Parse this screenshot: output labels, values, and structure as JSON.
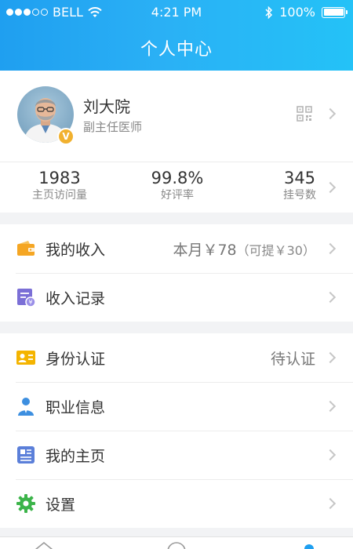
{
  "status_bar": {
    "carrier": "BELL",
    "time": "4:21 PM",
    "battery": "100%"
  },
  "nav": {
    "title": "个人中心"
  },
  "profile": {
    "name": "刘大院",
    "title": "副主任医师",
    "badge": "V"
  },
  "stats": [
    {
      "value": "1983",
      "label": "主页访问量"
    },
    {
      "value": "99.8%",
      "label": "好评率"
    },
    {
      "value": "345",
      "label": "挂号数"
    }
  ],
  "income": {
    "my_income": {
      "label": "我的收入",
      "value": "本月￥78",
      "sub": "（可提￥30）"
    },
    "records": {
      "label": "收入记录"
    }
  },
  "menu": {
    "identity": {
      "label": "身份认证",
      "value": "待认证"
    },
    "career": {
      "label": "职业信息"
    },
    "homepage": {
      "label": "我的主页"
    },
    "settings": {
      "label": "设置"
    }
  },
  "colors": {
    "header_start": "#1f9ff0",
    "header_end": "#24c2f7",
    "badge": "#f1b12f",
    "wallet": "#f5a623",
    "records": "#7b6fd6",
    "identity": "#f4b400",
    "career": "#3d8fe0",
    "homepage": "#5b7fd9",
    "settings": "#3cb44a"
  }
}
